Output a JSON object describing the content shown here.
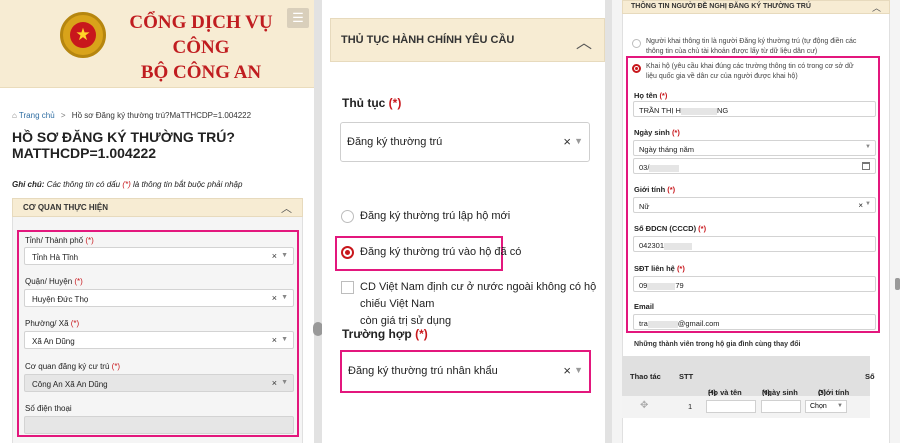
{
  "header": {
    "title_line1": "CỔNG DỊCH VỤ CÔNG",
    "title_line2": "BỘ CÔNG AN",
    "menu_icon": "☰"
  },
  "breadcrumb": {
    "home": "Trang chủ",
    "separator": ">",
    "current": "Hồ sơ Đăng ký thường trú?MaTTHCDP=1.004222"
  },
  "page": {
    "title": "HỒ SƠ ĐĂNG KÝ THƯỜNG TRÚ? MATTHCDP=1.004222",
    "note_prefix": "Ghi chú:",
    "note_text": "Các thông tin có dấu",
    "note_mark": "(*)",
    "note_suffix": "là thông tin bắt buộc phải nhập"
  },
  "agency_section": {
    "title": "CƠ QUAN THỰC HIỆN",
    "fields": {
      "province_label": "Tỉnh/ Thành phố",
      "province_value": "Tỉnh Hà Tĩnh",
      "district_label": "Quận/ Huyện",
      "district_value": "Huyện Đức Thọ",
      "ward_label": "Phường/ Xã",
      "ward_value": "Xã An Dũng",
      "office_label": "Cơ quan đăng ký cư trú",
      "office_value": "Công An Xã An Dũng",
      "phone_label": "Số điện thoại"
    },
    "required_mark": "(*)"
  },
  "procedure_section": {
    "title": "THỦ TỤC HÀNH CHÍNH YÊU CẦU",
    "procedure_label": "Thủ tục",
    "procedure_value": "Đăng ký thường trú",
    "option_new_household": "Đăng ký thường trú lập hộ mới",
    "option_existing_household": "Đăng ký thường trú vào hộ đã có",
    "overseas_checkbox_line1": "CD Việt Nam định cư ở nước ngoài không có hộ chiếu Việt Nam",
    "overseas_checkbox_line2": "còn giá trị sử dụng",
    "case_label": "Trường hợp",
    "case_value": "Đăng ký thường trú nhân khẩu",
    "required_mark": "(*)"
  },
  "applicant_section": {
    "title": "THÔNG TIN NGƯỜI ĐỀ NGHỊ ĐĂNG KÝ THƯỜNG TRÚ",
    "option_self_line1": "Người khai thông tin là người Đăng ký thường trú (tự động điền các",
    "option_self_line2": "thông tin của chủ tài khoản được lấy từ dữ liệu dân cư)",
    "option_proxy_line1": "Khai hộ (yêu cầu khai đúng các trường thông tin có trong cơ sở dữ",
    "option_proxy_line2": "liệu quốc gia về dân cư của người được khai hộ)",
    "fullname_label": "Họ tên",
    "fullname_value": "TRẦN THỊ H",
    "fullname_tail": "NG",
    "dob_label": "Ngày sinh",
    "dob_format": "Ngày tháng năm",
    "dob_value": "03/",
    "gender_label": "Giới tính",
    "gender_value": "Nữ",
    "id_label": "Số ĐDCN (CCCD)",
    "id_value": "042301",
    "phone_label": "SĐT liên hệ",
    "phone_value": "09",
    "phone_tail": "79",
    "email_label": "Email",
    "email_value_start": "tra",
    "email_value_end": "@gmail.com",
    "required_mark": "(*)",
    "family_title": "Những thành viên trong hộ gia đình cùng thay đổi",
    "table_headers": [
      "Thao tác",
      "STT",
      "Họ và tên",
      "Ngày sinh",
      "Giới tính",
      "Số"
    ],
    "row": {
      "stt": "1",
      "gender_placeholder": "Chọn"
    }
  },
  "colors": {
    "brand_red": "#c01d20",
    "highlight": "#e3177d",
    "header_bg": "#f7ecd3"
  }
}
